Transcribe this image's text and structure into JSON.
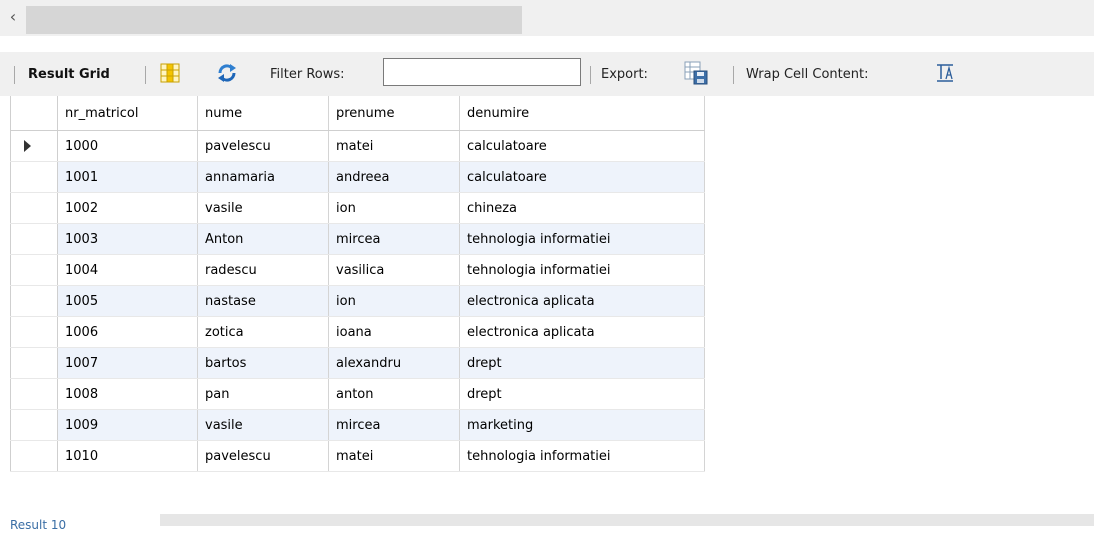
{
  "toolbar": {
    "result_grid_label": "Result Grid",
    "filter_rows_label": "Filter Rows:",
    "filter_value": "",
    "export_label": "Export:",
    "wrap_label": "Wrap Cell Content:"
  },
  "grid": {
    "columns": [
      "nr_matricol",
      "nume",
      "prenume",
      "denumire"
    ],
    "rows": [
      [
        "1000",
        "pavelescu",
        "matei",
        "calculatoare"
      ],
      [
        "1001",
        "annamaria",
        "andreea",
        "calculatoare"
      ],
      [
        "1002",
        "vasile",
        "ion",
        "chineza"
      ],
      [
        "1003",
        "Anton",
        "mircea",
        "tehnologia informatiei"
      ],
      [
        "1004",
        "radescu",
        "vasilica",
        "tehnologia informatiei"
      ],
      [
        "1005",
        "nastase",
        "ion",
        "electronica aplicata"
      ],
      [
        "1006",
        "zotica",
        "ioana",
        "electronica aplicata"
      ],
      [
        "1007",
        "bartos",
        "alexandru",
        "drept"
      ],
      [
        "1008",
        "pan",
        "anton",
        "drept"
      ],
      [
        "1009",
        "vasile",
        "mircea",
        "marketing"
      ],
      [
        "1010",
        "pavelescu",
        "matei",
        "tehnologia informatiei"
      ]
    ]
  },
  "bottom_tab": "Result 10",
  "icons": {
    "scroll_left": "chevron-left-icon",
    "grid_view": "grid-view-icon",
    "refresh": "refresh-icon",
    "export": "export-icon",
    "wrap": "wrap-text-icon"
  }
}
